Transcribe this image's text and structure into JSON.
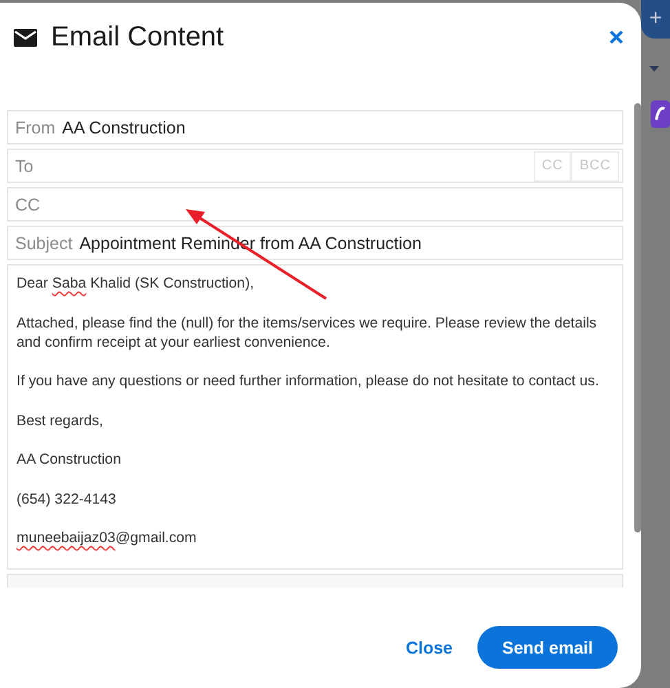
{
  "dialog": {
    "title": "Email Content",
    "fields": [
      {
        "label": "From",
        "value": "AA Construction"
      },
      {
        "label": "To",
        "extras": [
          "CC",
          "BCC"
        ]
      },
      {
        "label": "CC"
      },
      {
        "label": "Subject",
        "value": "Appointment Reminder from AA Construction"
      }
    ],
    "body": [
      [
        {
          "text": "Dear "
        },
        {
          "text": "Saba",
          "misspelled": true
        },
        {
          "text": " Khalid (SK Construction),"
        }
      ],
      [
        {
          "text": "Attached, please find the (null) for the items/services we require. Please review the details and confirm receipt at your earliest convenience."
        }
      ],
      [
        {
          "text": "If you have any questions or need further information, please do not hesitate to contact us."
        }
      ],
      [
        {
          "text": "Best regards,"
        }
      ],
      [
        {
          "text": "AA Construction"
        }
      ],
      [
        {
          "text": "(654) 322-4143"
        }
      ],
      [
        {
          "text": "muneebaijaz03",
          "misspelled": true
        },
        {
          "text": "@gmail.com"
        }
      ]
    ],
    "buttons": [
      {
        "label": "Close",
        "kind": "text"
      },
      {
        "label": "Send email",
        "kind": "primary"
      }
    ]
  },
  "background": {
    "add_button": "+"
  }
}
